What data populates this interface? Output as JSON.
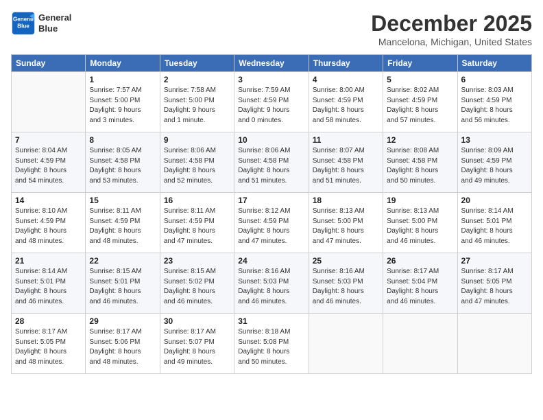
{
  "header": {
    "logo_line1": "General",
    "logo_line2": "Blue",
    "month": "December 2025",
    "location": "Mancelona, Michigan, United States"
  },
  "weekdays": [
    "Sunday",
    "Monday",
    "Tuesday",
    "Wednesday",
    "Thursday",
    "Friday",
    "Saturday"
  ],
  "weeks": [
    [
      {
        "day": "",
        "info": ""
      },
      {
        "day": "1",
        "info": "Sunrise: 7:57 AM\nSunset: 5:00 PM\nDaylight: 9 hours\nand 3 minutes."
      },
      {
        "day": "2",
        "info": "Sunrise: 7:58 AM\nSunset: 5:00 PM\nDaylight: 9 hours\nand 1 minute."
      },
      {
        "day": "3",
        "info": "Sunrise: 7:59 AM\nSunset: 4:59 PM\nDaylight: 9 hours\nand 0 minutes."
      },
      {
        "day": "4",
        "info": "Sunrise: 8:00 AM\nSunset: 4:59 PM\nDaylight: 8 hours\nand 58 minutes."
      },
      {
        "day": "5",
        "info": "Sunrise: 8:02 AM\nSunset: 4:59 PM\nDaylight: 8 hours\nand 57 minutes."
      },
      {
        "day": "6",
        "info": "Sunrise: 8:03 AM\nSunset: 4:59 PM\nDaylight: 8 hours\nand 56 minutes."
      }
    ],
    [
      {
        "day": "7",
        "info": "Sunrise: 8:04 AM\nSunset: 4:59 PM\nDaylight: 8 hours\nand 54 minutes."
      },
      {
        "day": "8",
        "info": "Sunrise: 8:05 AM\nSunset: 4:58 PM\nDaylight: 8 hours\nand 53 minutes."
      },
      {
        "day": "9",
        "info": "Sunrise: 8:06 AM\nSunset: 4:58 PM\nDaylight: 8 hours\nand 52 minutes."
      },
      {
        "day": "10",
        "info": "Sunrise: 8:06 AM\nSunset: 4:58 PM\nDaylight: 8 hours\nand 51 minutes."
      },
      {
        "day": "11",
        "info": "Sunrise: 8:07 AM\nSunset: 4:58 PM\nDaylight: 8 hours\nand 51 minutes."
      },
      {
        "day": "12",
        "info": "Sunrise: 8:08 AM\nSunset: 4:58 PM\nDaylight: 8 hours\nand 50 minutes."
      },
      {
        "day": "13",
        "info": "Sunrise: 8:09 AM\nSunset: 4:59 PM\nDaylight: 8 hours\nand 49 minutes."
      }
    ],
    [
      {
        "day": "14",
        "info": "Sunrise: 8:10 AM\nSunset: 4:59 PM\nDaylight: 8 hours\nand 48 minutes."
      },
      {
        "day": "15",
        "info": "Sunrise: 8:11 AM\nSunset: 4:59 PM\nDaylight: 8 hours\nand 48 minutes."
      },
      {
        "day": "16",
        "info": "Sunrise: 8:11 AM\nSunset: 4:59 PM\nDaylight: 8 hours\nand 47 minutes."
      },
      {
        "day": "17",
        "info": "Sunrise: 8:12 AM\nSunset: 4:59 PM\nDaylight: 8 hours\nand 47 minutes."
      },
      {
        "day": "18",
        "info": "Sunrise: 8:13 AM\nSunset: 5:00 PM\nDaylight: 8 hours\nand 47 minutes."
      },
      {
        "day": "19",
        "info": "Sunrise: 8:13 AM\nSunset: 5:00 PM\nDaylight: 8 hours\nand 46 minutes."
      },
      {
        "day": "20",
        "info": "Sunrise: 8:14 AM\nSunset: 5:01 PM\nDaylight: 8 hours\nand 46 minutes."
      }
    ],
    [
      {
        "day": "21",
        "info": "Sunrise: 8:14 AM\nSunset: 5:01 PM\nDaylight: 8 hours\nand 46 minutes."
      },
      {
        "day": "22",
        "info": "Sunrise: 8:15 AM\nSunset: 5:01 PM\nDaylight: 8 hours\nand 46 minutes."
      },
      {
        "day": "23",
        "info": "Sunrise: 8:15 AM\nSunset: 5:02 PM\nDaylight: 8 hours\nand 46 minutes."
      },
      {
        "day": "24",
        "info": "Sunrise: 8:16 AM\nSunset: 5:03 PM\nDaylight: 8 hours\nand 46 minutes."
      },
      {
        "day": "25",
        "info": "Sunrise: 8:16 AM\nSunset: 5:03 PM\nDaylight: 8 hours\nand 46 minutes."
      },
      {
        "day": "26",
        "info": "Sunrise: 8:17 AM\nSunset: 5:04 PM\nDaylight: 8 hours\nand 46 minutes."
      },
      {
        "day": "27",
        "info": "Sunrise: 8:17 AM\nSunset: 5:05 PM\nDaylight: 8 hours\nand 47 minutes."
      }
    ],
    [
      {
        "day": "28",
        "info": "Sunrise: 8:17 AM\nSunset: 5:05 PM\nDaylight: 8 hours\nand 48 minutes."
      },
      {
        "day": "29",
        "info": "Sunrise: 8:17 AM\nSunset: 5:06 PM\nDaylight: 8 hours\nand 48 minutes."
      },
      {
        "day": "30",
        "info": "Sunrise: 8:17 AM\nSunset: 5:07 PM\nDaylight: 8 hours\nand 49 minutes."
      },
      {
        "day": "31",
        "info": "Sunrise: 8:18 AM\nSunset: 5:08 PM\nDaylight: 8 hours\nand 50 minutes."
      },
      {
        "day": "",
        "info": ""
      },
      {
        "day": "",
        "info": ""
      },
      {
        "day": "",
        "info": ""
      }
    ]
  ]
}
